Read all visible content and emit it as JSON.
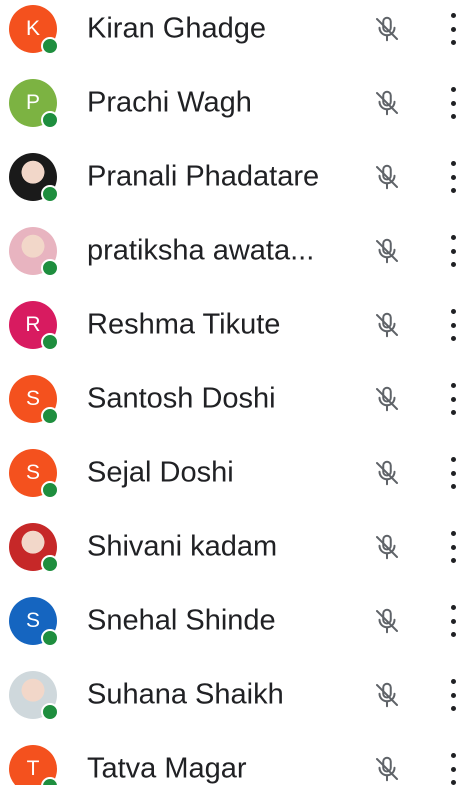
{
  "participants": [
    {
      "initial": "K",
      "name": "Kiran Ghadge",
      "avatar_color": "#f4511e",
      "photo": false,
      "mic_icon": "mic-off-icon",
      "more_icon": "more-vert-icon"
    },
    {
      "initial": "P",
      "name": "Prachi Wagh",
      "avatar_color": "#7cb342",
      "photo": false,
      "mic_icon": "mic-off-icon",
      "more_icon": "more-vert-icon"
    },
    {
      "initial": "",
      "name": "Pranali Phadatare",
      "avatar_color": "#1a1a1a",
      "photo": true,
      "mic_icon": "mic-off-icon",
      "more_icon": "more-vert-icon"
    },
    {
      "initial": "",
      "name": "pratiksha awata...",
      "avatar_color": "#e8b4c0",
      "photo": true,
      "mic_icon": "mic-off-icon",
      "more_icon": "more-vert-icon"
    },
    {
      "initial": "R",
      "name": "Reshma Tikute",
      "avatar_color": "#d81b60",
      "photo": false,
      "mic_icon": "mic-off-icon",
      "more_icon": "more-vert-icon"
    },
    {
      "initial": "S",
      "name": "Santosh Doshi",
      "avatar_color": "#f4511e",
      "photo": false,
      "mic_icon": "mic-off-icon",
      "more_icon": "more-vert-icon"
    },
    {
      "initial": "S",
      "name": "Sejal Doshi",
      "avatar_color": "#f4511e",
      "photo": false,
      "mic_icon": "mic-off-icon",
      "more_icon": "more-vert-icon"
    },
    {
      "initial": "",
      "name": "Shivani kadam",
      "avatar_color": "#c62828",
      "photo": true,
      "mic_icon": "mic-off-icon",
      "more_icon": "more-vert-icon"
    },
    {
      "initial": "S",
      "name": "Snehal Shinde",
      "avatar_color": "#1565c0",
      "photo": false,
      "mic_icon": "mic-off-icon",
      "more_icon": "more-vert-icon"
    },
    {
      "initial": "",
      "name": "Suhana Shaikh",
      "avatar_color": "#cfd8dc",
      "photo": true,
      "mic_icon": "mic-off-icon",
      "more_icon": "more-vert-icon"
    },
    {
      "initial": "T",
      "name": "Tatva Magar",
      "avatar_color": "#f4511e",
      "photo": false,
      "mic_icon": "mic-off-icon",
      "more_icon": "more-vert-icon"
    }
  ],
  "colors": {
    "status_online": "#1e8e3e",
    "text": "#202124",
    "icon": "#5f6368"
  }
}
